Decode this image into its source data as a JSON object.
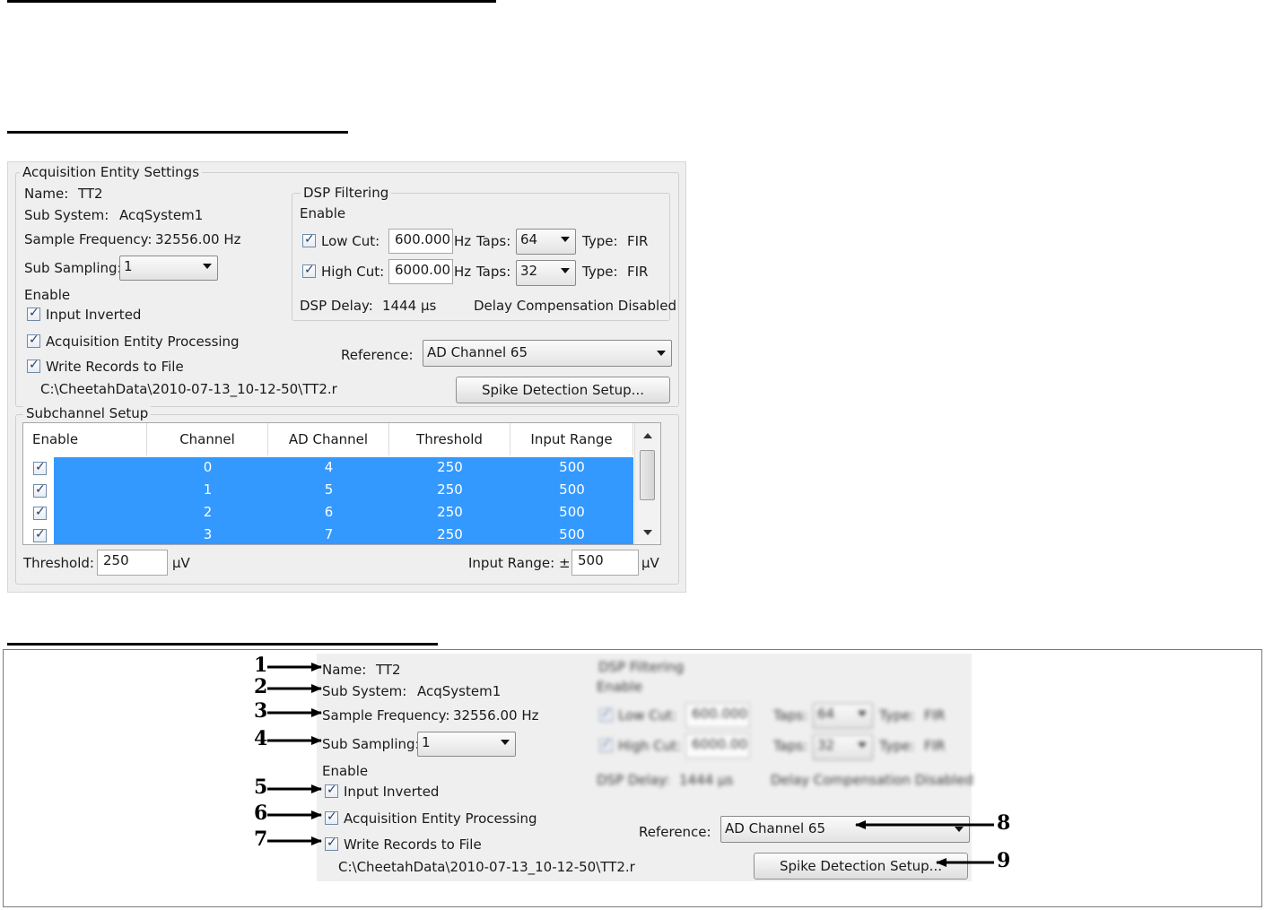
{
  "settings": {
    "group_title": "Acquisition Entity Settings",
    "name_label": "Name:",
    "name_value": "TT2",
    "subsystem_label": "Sub System:",
    "subsystem_value": "AcqSystem1",
    "freq_label": "Sample Frequency:",
    "freq_value": "32556.00 Hz",
    "subsampling_label": "Sub Sampling:",
    "subsampling_value": "1",
    "enable_label": "Enable",
    "input_inverted": "Input Inverted",
    "acq_processing": "Acquisition Entity Processing",
    "write_records": "Write Records to File",
    "file_path": "C:\\CheetahData\\2010-07-13_10-12-50\\TT2.r",
    "reference_label": "Reference:",
    "reference_value": "AD Channel 65",
    "spike_button": "Spike Detection Setup..."
  },
  "dsp": {
    "title": "DSP Filtering",
    "enable_label": "Enable",
    "low_cut_label": "Low Cut:",
    "low_cut_value": "600.000",
    "high_cut_label": "High Cut:",
    "high_cut_value": "6000.00",
    "hz": "Hz",
    "taps_label": "Taps:",
    "low_taps": "64",
    "high_taps": "32",
    "type_label": "Type:",
    "type_value": "FIR",
    "delay_label": "DSP Delay:",
    "delay_value": "1444 µs",
    "delay_comp": "Delay Compensation Disabled"
  },
  "subchannel": {
    "title": "Subchannel Setup",
    "columns": [
      "Enable",
      "Channel",
      "AD Channel",
      "Threshold",
      "Input Range"
    ],
    "rows": [
      {
        "channel": "0",
        "ad": "4",
        "threshold": "250",
        "range": "500"
      },
      {
        "channel": "1",
        "ad": "5",
        "threshold": "250",
        "range": "500"
      },
      {
        "channel": "2",
        "ad": "6",
        "threshold": "250",
        "range": "500"
      },
      {
        "channel": "3",
        "ad": "7",
        "threshold": "250",
        "range": "500"
      }
    ],
    "threshold_label": "Threshold:",
    "threshold_value": "250",
    "unit": "µV",
    "input_range_label": "Input Range: ±",
    "input_range_value": "500"
  },
  "callouts": [
    "1",
    "2",
    "3",
    "4",
    "5",
    "6",
    "7",
    "8",
    "9"
  ],
  "colors": {
    "selection": "#3399ff",
    "panel_bg": "#efefef"
  }
}
